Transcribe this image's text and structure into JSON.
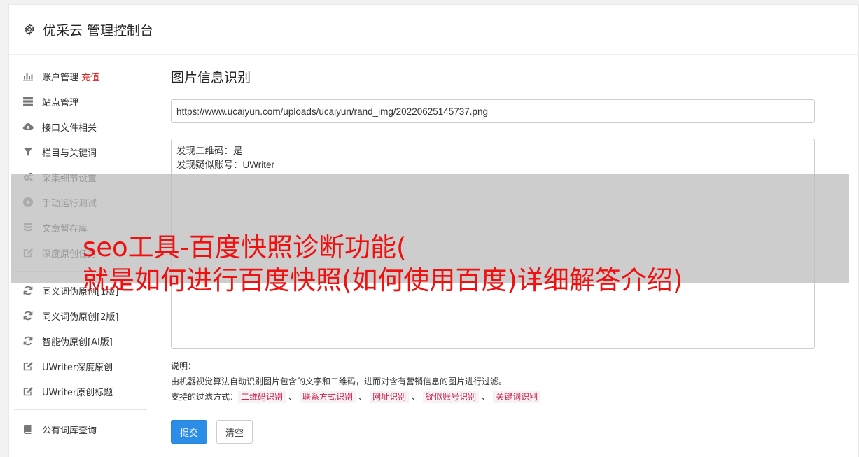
{
  "header": {
    "title": "优采云 管理控制台"
  },
  "sidebar": {
    "group1": [
      {
        "label": "账户管理",
        "badge": "充值",
        "icon": "bar-chart-icon"
      },
      {
        "label": "站点管理",
        "icon": "server-icon"
      },
      {
        "label": "接口文件相关",
        "icon": "cloud-upload-icon"
      },
      {
        "label": "栏目与关键词",
        "icon": "filter-icon"
      },
      {
        "label": "采集细节设置",
        "icon": "gears-icon"
      },
      {
        "label": "手动运行测试",
        "icon": "play-icon"
      },
      {
        "label": "文章暂存库",
        "icon": "database-icon"
      },
      {
        "label": "深度原创任务",
        "icon": "edit-icon"
      }
    ],
    "group2": [
      {
        "label": "同义词伪原创[1版]",
        "icon": "refresh-icon"
      },
      {
        "label": "同义词伪原创[2版]",
        "icon": "refresh-icon"
      },
      {
        "label": "智能伪原创[AI版]",
        "icon": "refresh-icon"
      },
      {
        "label": "UWriter深度原创",
        "icon": "edit-icon"
      },
      {
        "label": "UWriter原创标题",
        "icon": "edit-icon"
      }
    ],
    "group3": [
      {
        "label": "公有词库查询",
        "icon": "book-icon"
      }
    ]
  },
  "main": {
    "title": "图片信息识别",
    "url_value": "https://www.ucaiyun.com/uploads/ucaiyun/rand_img/20220625145737.png",
    "result_text": "发现二维码：是\n发现疑似账号：UWriter",
    "desc_label": "说明：",
    "desc_text": "由机器视觉算法自动识别图片包含的文字和二维码，进而对含有营销信息的图片进行过滤。",
    "filter_label": "支持的过滤方式：",
    "filters": [
      "二维码识别",
      "联系方式识别",
      "网址识别",
      "疑似账号识别",
      "关键词识别"
    ],
    "filter_sep": "、",
    "submit_label": "提交",
    "clear_label": "清空"
  },
  "overlay": {
    "line1": "seo工具-百度快照诊断功能(",
    "line2": "就是如何进行百度快照(如何使用百度)详细解答介绍)"
  },
  "colors": {
    "accent": "#2c8de6",
    "badge": "#e01b1b",
    "headline": "#f01010",
    "tag_text": "#c7254e",
    "tag_bg": "#f9f2f4"
  }
}
